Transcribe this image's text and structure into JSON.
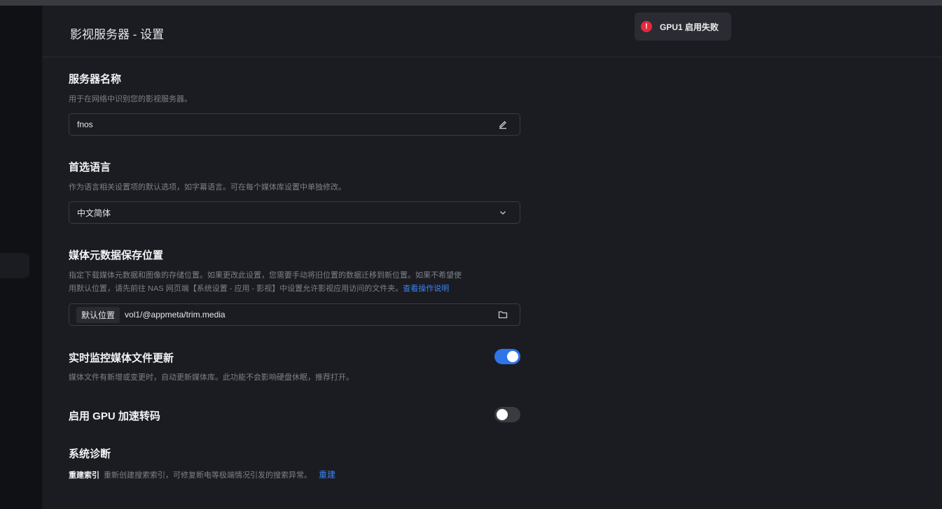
{
  "header": {
    "title": "影视服务器 - 设置"
  },
  "toast": {
    "icon": "error-icon",
    "text": "GPU1 启用失败",
    "color": "#e8283a"
  },
  "server_name": {
    "title": "服务器名称",
    "description": "用于在网络中识别您的影视服务器。",
    "value": "fnos",
    "edit_icon": "edit-icon"
  },
  "language": {
    "title": "首选语言",
    "description": "作为语言相关设置项的默认选项，如字幕语言。可在每个媒体库设置中单独修改。",
    "selected": "中文简体",
    "dropdown_icon": "chevron-down-icon"
  },
  "metadata_location": {
    "title": "媒体元数据保存位置",
    "description_line1": "指定下载媒体元数据和图像的存储位置。如果更改此设置，您需要手动将旧位置的数据迁移到新位置。如果不希望使",
    "description_line2": "用默认位置，请先前往 NAS 网页端【系统设置 - 应用 - 影视】中设置允许影视应用访问的文件夹。",
    "help_link": "查看操作说明",
    "tag": "默认位置",
    "path": "vol1/@appmeta/trim.media",
    "folder_icon": "folder-icon"
  },
  "realtime_monitor": {
    "title": "实时监控媒体文件更新",
    "description": "媒体文件有新增或变更时，自动更新媒体库。此功能不会影响硬盘休眠，推荐打开。",
    "enabled": true,
    "accent": "#2f74e8"
  },
  "gpu_transcode": {
    "title": "启用 GPU 加速转码",
    "enabled": false
  },
  "diagnostics": {
    "title": "系统诊断",
    "rebuild_label": "重建索引",
    "rebuild_description": "重新创建搜索索引，可修复断电等极端情况引发的搜索异常。",
    "rebuild_link": "重建"
  }
}
